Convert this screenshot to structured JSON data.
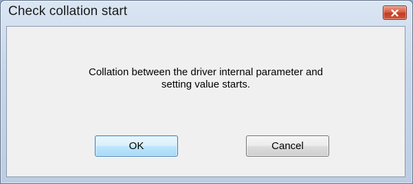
{
  "window": {
    "title": "Check collation start",
    "close_icon": "close-x-icon"
  },
  "dialog": {
    "message_line1": "Collation between the driver internal parameter and",
    "message_line2": "setting value starts."
  },
  "buttons": {
    "ok_label": "OK",
    "cancel_label": "Cancel"
  },
  "colors": {
    "titlebar": "#c7d6ea",
    "close_button": "#d95f44",
    "client_background": "#f0f0f0",
    "default_button": "#bee6fd"
  }
}
